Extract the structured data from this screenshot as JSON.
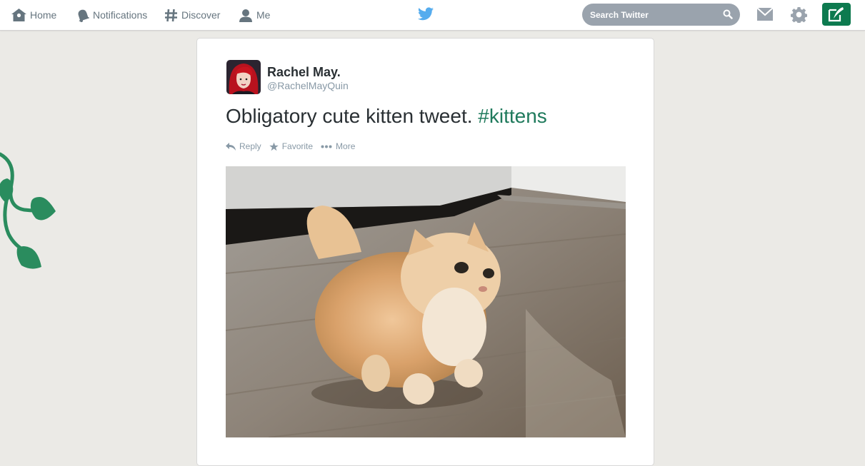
{
  "nav": {
    "home_label": "Home",
    "notifications_label": "Notifications",
    "discover_label": "Discover",
    "me_label": "Me"
  },
  "search": {
    "placeholder": "Search Twitter"
  },
  "tweet": {
    "author_name": "Rachel May.",
    "author_handle": "@RachelMayQuin",
    "text_plain": "Obligatory cute kitten tweet.",
    "hashtag": "#kittens",
    "actions": {
      "reply": "Reply",
      "favorite": "Favorite",
      "more": "More"
    }
  },
  "colors": {
    "accent": "#0d7a4f",
    "hashtag": "#1f7a5c",
    "background": "#ebeae6",
    "bird": "#55acee"
  },
  "icons": [
    "home-icon",
    "bell-icon",
    "hashtag-icon",
    "person-icon",
    "twitter-bird-icon",
    "search-icon",
    "envelope-icon",
    "gear-icon",
    "compose-icon",
    "reply-icon",
    "star-icon",
    "more-icon",
    "vine-decoration"
  ]
}
